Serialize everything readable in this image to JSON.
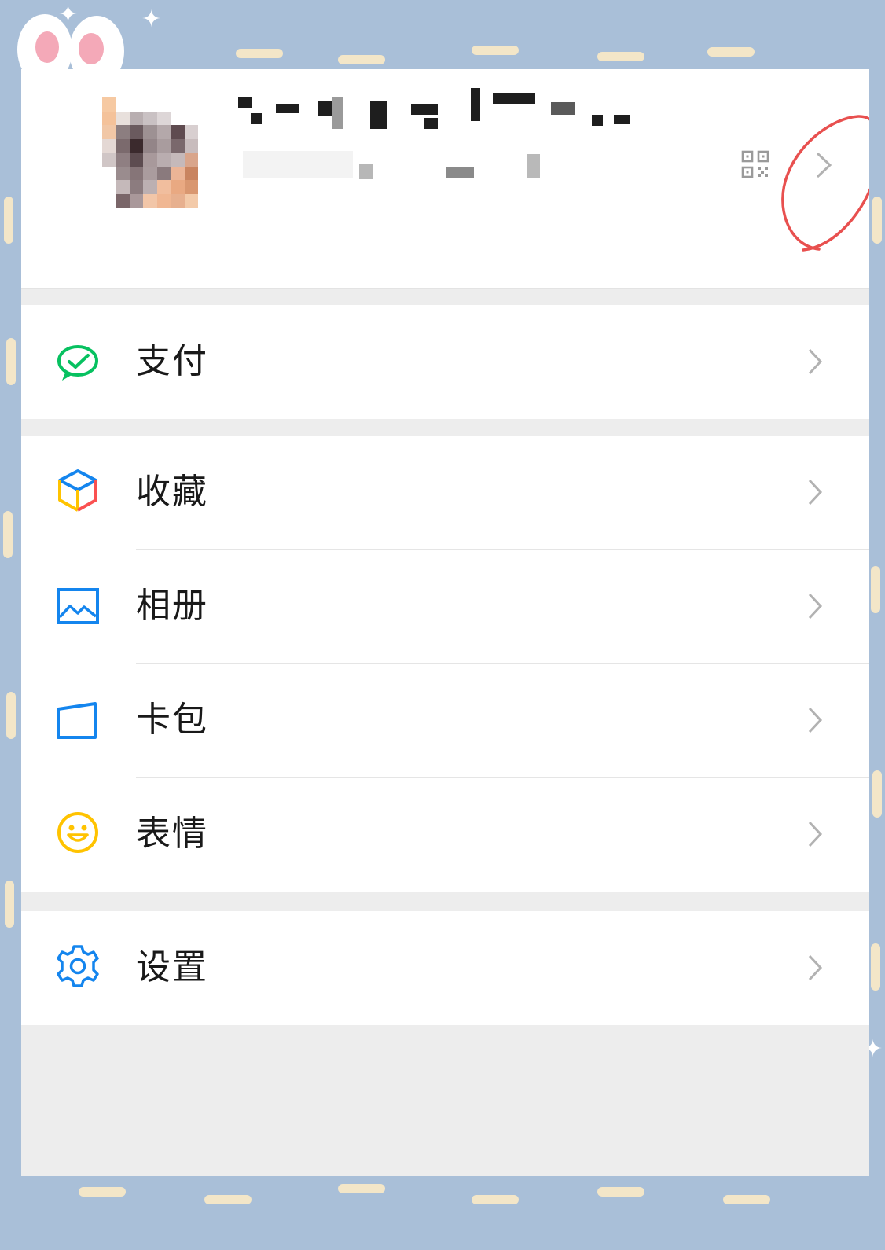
{
  "menu": {
    "pay": {
      "label": "支付",
      "icon": "wechat-pay-icon",
      "color": "#07c160"
    },
    "favorites": {
      "label": "收藏",
      "icon": "cube-icon"
    },
    "album": {
      "label": "相册",
      "icon": "photo-icon",
      "color": "#1485ee"
    },
    "cards": {
      "label": "卡包",
      "icon": "wallet-icon",
      "color": "#1485ee"
    },
    "stickers": {
      "label": "表情",
      "icon": "smiley-icon",
      "color": "#ffc300"
    },
    "settings": {
      "label": "设置",
      "icon": "gear-icon",
      "color": "#1485ee"
    }
  },
  "profile": {
    "qr_icon": "qr-code-icon",
    "annotation_color": "#e8504f"
  }
}
